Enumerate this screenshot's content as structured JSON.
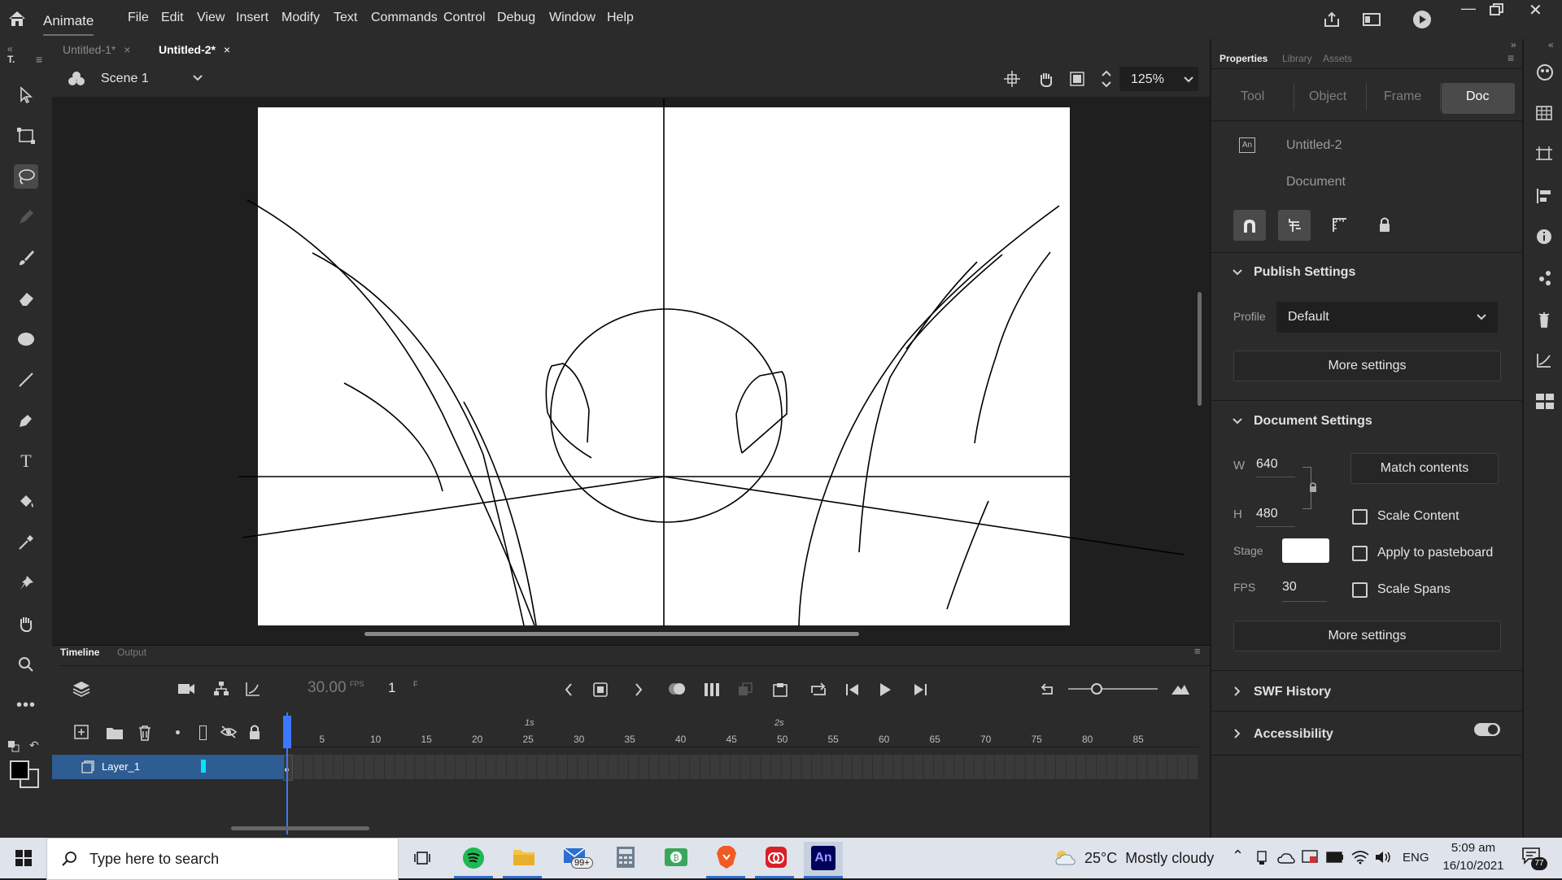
{
  "app": {
    "title": "Animate"
  },
  "menu": [
    "File",
    "Edit",
    "View",
    "Insert",
    "Modify",
    "Text",
    "Commands",
    "Control",
    "Debug",
    "Window",
    "Help"
  ],
  "doc_tabs": [
    {
      "label": "Untitled-1*",
      "active": false
    },
    {
      "label": "Untitled-2*",
      "active": true
    }
  ],
  "left_tool_header": "T.",
  "scene": {
    "name": "Scene 1",
    "zoom": "125%"
  },
  "timeline": {
    "tabs": [
      "Timeline",
      "Output"
    ],
    "fps": "30.00",
    "fps_unit": "FPS",
    "frame": "1",
    "frame_unit": "F",
    "layer": "Layer_1",
    "seconds": [
      "1s",
      "2s"
    ],
    "frame_ticks": [
      "5",
      "10",
      "15",
      "20",
      "25",
      "30",
      "35",
      "40",
      "45",
      "50",
      "55",
      "60",
      "65",
      "70",
      "75",
      "80",
      "85"
    ]
  },
  "properties": {
    "panel_tabs": [
      "Properties",
      "Library",
      "Assets"
    ],
    "sub_tabs": [
      "Tool",
      "Object",
      "Frame",
      "Doc"
    ],
    "doc_icon": "An",
    "doc_name": "Untitled-2",
    "doc_type": "Document",
    "publish": {
      "title": "Publish Settings",
      "profile_label": "Profile",
      "profile_value": "Default",
      "more": "More settings"
    },
    "document": {
      "title": "Document Settings",
      "w_label": "W",
      "w": "640",
      "h_label": "H",
      "h": "480",
      "stage_label": "Stage",
      "stage_color": "#ffffff",
      "fps_label": "FPS",
      "fps": "30",
      "match": "Match contents",
      "scale_content": "Scale Content",
      "apply_pasteboard": "Apply to pasteboard",
      "scale_spans": "Scale Spans",
      "more": "More settings"
    },
    "swf_history": "SWF History",
    "accessibility": "Accessibility"
  },
  "taskbar": {
    "search_placeholder": "Type here to search",
    "mail_badge": "99+",
    "weather": "25°C  Mostly cloudy",
    "lang": "ENG",
    "time": "5:09 am",
    "date": "16/10/2021",
    "notif": "77"
  },
  "colors": {
    "accent": "#2d5d92",
    "cyan": "#00e5ff",
    "playhead": "#3b78ff"
  }
}
